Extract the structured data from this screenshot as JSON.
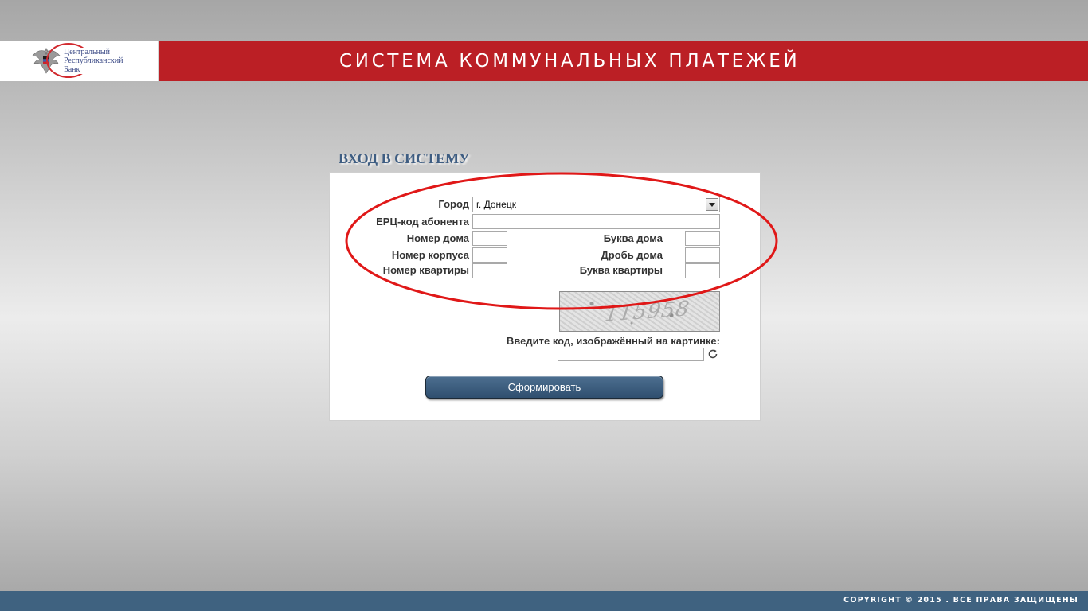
{
  "header": {
    "logo_lines": [
      "Центральный",
      "Республиканский",
      "Банк"
    ],
    "title": "СИСТЕМА КОММУНАЛЬНЫХ ПЛАТЕЖЕЙ",
    "colors": {
      "bar": "#bb1f25",
      "logo_text": "#3b4a86"
    }
  },
  "login": {
    "heading": "ВХОД В СИСТЕМУ",
    "city_label": "Город",
    "city_value": "г. Донецк",
    "erc_label": "ЕРЦ-код абонента",
    "erc_value": "",
    "house_label": "Номер дома",
    "house_letter_label": "Буква дома",
    "building_label": "Номер корпуса",
    "house_fraction_label": "Дробь дома",
    "apartment_label": "Номер квартиры",
    "apartment_letter_label": "Буква квартиры",
    "captcha_code": "115958",
    "captcha_label": "Введите код, изображённый на картинке:",
    "captcha_value": "",
    "submit_label": "Сформировать",
    "icons": {
      "select_arrow": "chevron-down-icon",
      "refresh": "refresh-icon"
    }
  },
  "footer": {
    "copyright": "COPYRIGHT © 2015 . ВСЕ ПРАВА ЗАЩИЩЕНЫ",
    "color": "#3f6280"
  }
}
